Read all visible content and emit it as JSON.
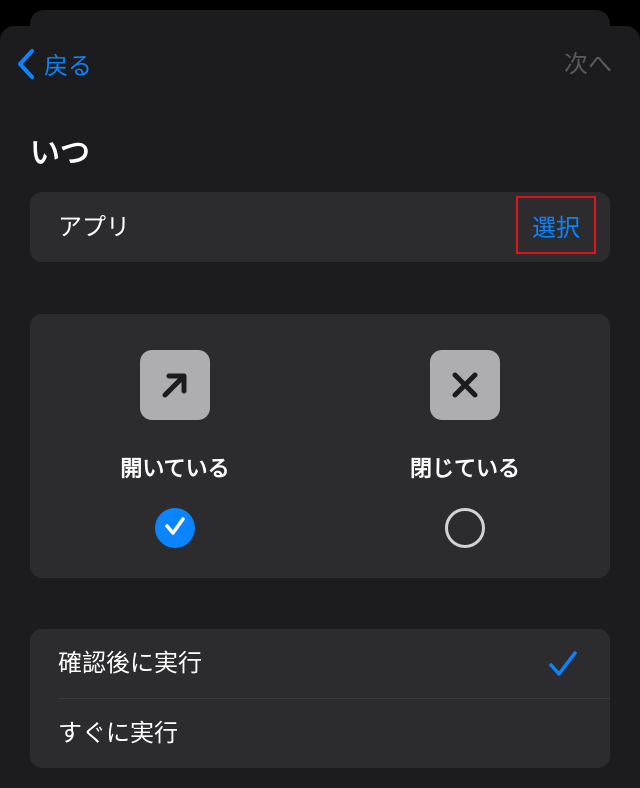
{
  "nav": {
    "back_label": "戻る",
    "next_label": "次へ"
  },
  "section": {
    "title": "いつ"
  },
  "app_row": {
    "label": "アプリ",
    "select_label": "選択"
  },
  "state_options": [
    {
      "label": "開いている",
      "icon": "arrow-up-right-icon",
      "selected": true
    },
    {
      "label": "閉じている",
      "icon": "xmark-icon",
      "selected": false
    }
  ],
  "run_options": [
    {
      "label": "確認後に実行",
      "selected": true
    },
    {
      "label": "すぐに実行",
      "selected": false
    }
  ],
  "colors": {
    "accent": "#0a84ff",
    "highlight_border": "#e0121b",
    "card": "#2c2c2e",
    "sheet": "#1c1c1e",
    "disabled_text": "#5a5a5e"
  }
}
